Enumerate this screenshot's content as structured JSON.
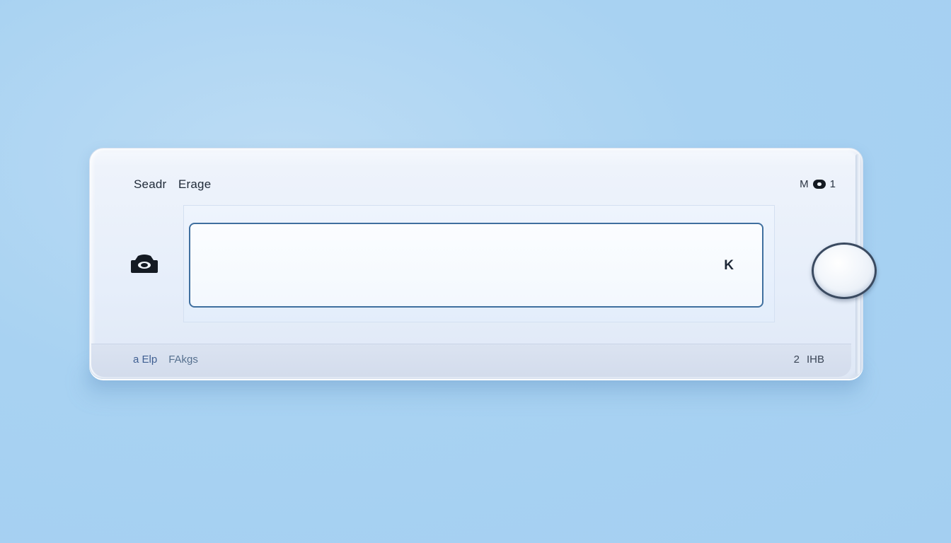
{
  "header": {
    "search_label": "Seadr",
    "erage_label": "Erage",
    "right_letter": "M",
    "right_icon": "toggle-dot-icon",
    "right_number": "1"
  },
  "main": {
    "left_icon": "camera-icon",
    "input_value": "",
    "input_placeholder": "",
    "end_icon_text": "K"
  },
  "footer": {
    "left_item_1": "a Elp",
    "left_item_2": "FAkgs",
    "right_number": "2",
    "right_text": "IHB"
  },
  "colors": {
    "background": "#a8d2f2",
    "field_border": "#3f6f9f",
    "knob_border": "#3a4a60"
  }
}
